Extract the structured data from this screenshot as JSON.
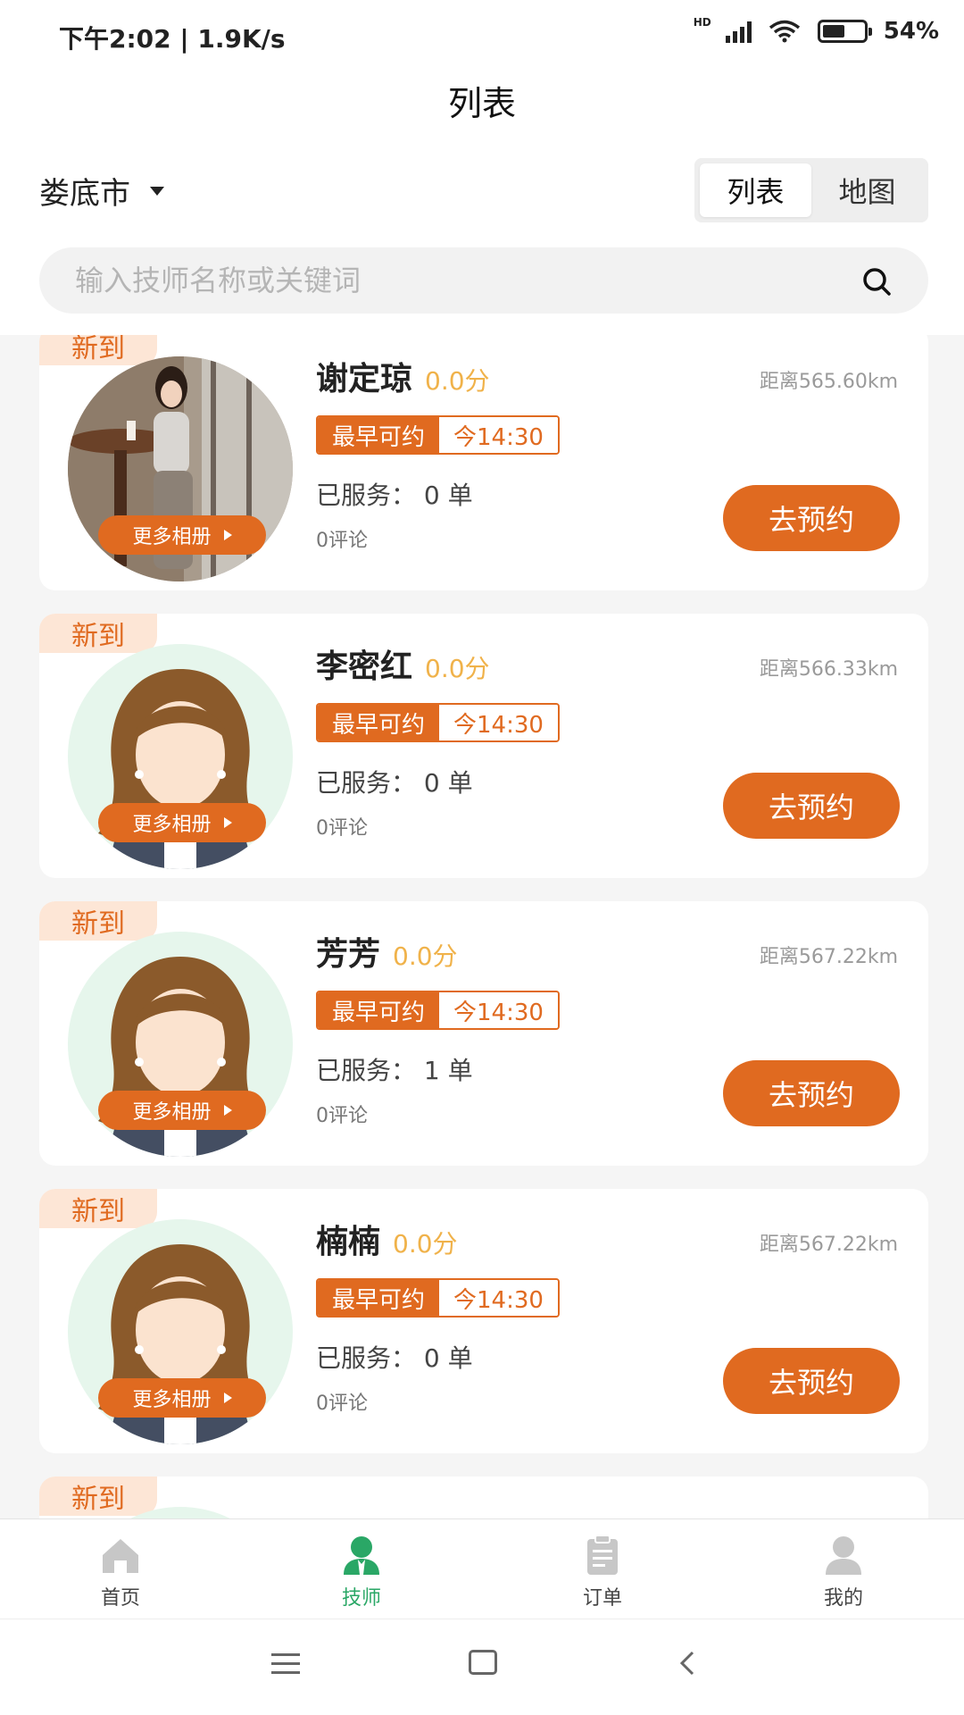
{
  "status_bar": {
    "time": "下午2:02 | 1.9K/s",
    "battery": "54%",
    "net": "HD"
  },
  "header": {
    "title": "列表"
  },
  "filter": {
    "city": "娄底市",
    "toggle": [
      "列表",
      "地图"
    ],
    "active_toggle": "列表"
  },
  "search": {
    "placeholder": "输入技师名称或关键词"
  },
  "colors": {
    "accent": "#e06a20",
    "active_tab": "#2aa766",
    "score": "#f0b24a"
  },
  "therapists": [
    {
      "tag": "新到",
      "name": "谢定琼",
      "score": "0.0分",
      "distance": "距离565.60km",
      "earliest_label": "最早可约",
      "earliest_time": "今14:30",
      "served": "已服务：  0 单",
      "comments": "0评论",
      "album": "更多相册",
      "book": "去预约",
      "avatar": "photo"
    },
    {
      "tag": "新到",
      "name": "李密红",
      "score": "0.0分",
      "distance": "距离566.33km",
      "earliest_label": "最早可约",
      "earliest_time": "今14:30",
      "served": "已服务：  0 单",
      "comments": "0评论",
      "album": "更多相册",
      "book": "去预约",
      "avatar": "default-avatar"
    },
    {
      "tag": "新到",
      "name": "芳芳",
      "score": "0.0分",
      "distance": "距离567.22km",
      "earliest_label": "最早可约",
      "earliest_time": "今14:30",
      "served": "已服务：  1 单",
      "comments": "0评论",
      "album": "更多相册",
      "book": "去预约",
      "avatar": "default-avatar"
    },
    {
      "tag": "新到",
      "name": "楠楠",
      "score": "0.0分",
      "distance": "距离567.22km",
      "earliest_label": "最早可约",
      "earliest_time": "今14:30",
      "served": "已服务：  0 单",
      "comments": "0评论",
      "album": "更多相册",
      "book": "去预约",
      "avatar": "default-avatar"
    },
    {
      "tag": "新到"
    }
  ],
  "tabbar": [
    {
      "label": "首页",
      "icon": "home-icon"
    },
    {
      "label": "技师",
      "icon": "technician-icon",
      "active": true
    },
    {
      "label": "订单",
      "icon": "order-icon"
    },
    {
      "label": "我的",
      "icon": "profile-icon"
    }
  ]
}
